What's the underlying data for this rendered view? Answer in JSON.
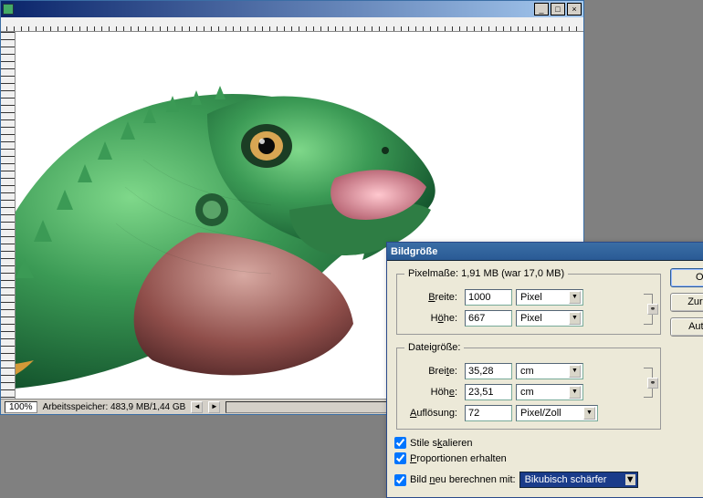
{
  "docWindow": {
    "winButtons": {
      "min": "_",
      "max": "□",
      "close": "×"
    }
  },
  "status": {
    "zoom": "100%",
    "memory": "Arbeitsspeicher: 483,9 MB/1,44 GB",
    "navPrev": "◄",
    "navNext": "►"
  },
  "dialog": {
    "title": "Bildgröße",
    "close": "×",
    "pixelSection": {
      "legend": "Pixelmaße: 1,91 MB (war 17,0 MB)",
      "widthLabel": "Breite:",
      "widthValue": "1000",
      "widthUnit": "Pixel",
      "heightLabel": "Höhe:",
      "heightValue": "667",
      "heightUnit": "Pixel"
    },
    "docSection": {
      "legend": "Dateigröße:",
      "widthLabel": "Breite:",
      "widthValue": "35,28",
      "widthUnit": "cm",
      "heightLabel": "Höhe:",
      "heightValue": "23,51",
      "heightUnit": "cm",
      "resLabel": "Auflösung:",
      "resValue": "72",
      "resUnit": "Pixel/Zoll"
    },
    "checks": {
      "scaleStyles": "Stile skalieren",
      "constrain": "Proportionen erhalten",
      "resample": "Bild neu berechnen mit:",
      "method": "Bikubisch schärfer"
    },
    "buttons": {
      "ok": "OK",
      "back": "Zurück",
      "auto": "Auto..."
    },
    "linkKnob": "⚭",
    "dropdownArrow": "▼"
  }
}
